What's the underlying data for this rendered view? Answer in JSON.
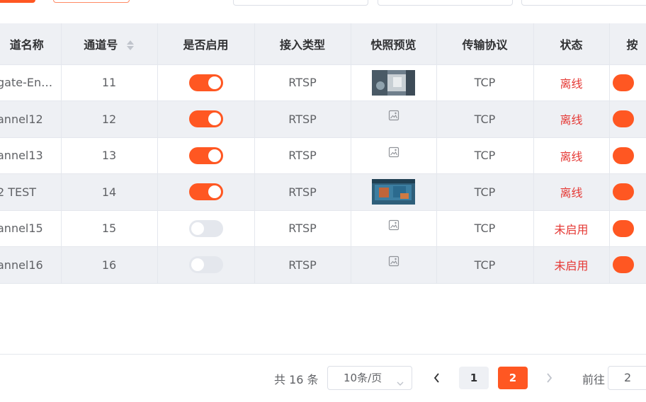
{
  "toolbar": {},
  "table": {
    "headers": {
      "name": "道名称",
      "number": "通道号",
      "enabled": "是否启用",
      "access_type": "接入类型",
      "snapshot": "快照预览",
      "protocol": "传输协议",
      "status": "状态",
      "op": "按"
    },
    "rows": [
      {
        "name": "gate-En…",
        "number": "11",
        "enabled": true,
        "access_type": "RTSP",
        "snapshot": "photo",
        "protocol": "TCP",
        "status": "离线"
      },
      {
        "name": "annel12",
        "number": "12",
        "enabled": true,
        "access_type": "RTSP",
        "snapshot": "placeholder",
        "protocol": "TCP",
        "status": "离线"
      },
      {
        "name": "annel13",
        "number": "13",
        "enabled": true,
        "access_type": "RTSP",
        "snapshot": "placeholder",
        "protocol": "TCP",
        "status": "离线"
      },
      {
        "name": "2 TEST",
        "number": "14",
        "enabled": true,
        "access_type": "RTSP",
        "snapshot": "photo",
        "protocol": "TCP",
        "status": "离线"
      },
      {
        "name": "annel15",
        "number": "15",
        "enabled": false,
        "access_type": "RTSP",
        "snapshot": "placeholder",
        "protocol": "TCP",
        "status": "未启用"
      },
      {
        "name": "annel16",
        "number": "16",
        "enabled": false,
        "access_type": "RTSP",
        "snapshot": "placeholder",
        "protocol": "TCP",
        "status": "未启用"
      }
    ]
  },
  "pagination": {
    "total": "共 16 条",
    "page_size": "10条/页",
    "pages": [
      "1",
      "2"
    ],
    "current_page": "2",
    "goto_label": "前往",
    "goto_value": "2"
  },
  "colors": {
    "accent": "#ff5722",
    "status_red": "#e53935",
    "header_bg": "#eef0f4"
  },
  "icons": {
    "sort": "sort-caret-icon",
    "image": "image-placeholder-icon",
    "prev": "chevron-left-icon",
    "next": "chevron-right-icon",
    "select": "chevron-down-icon"
  }
}
